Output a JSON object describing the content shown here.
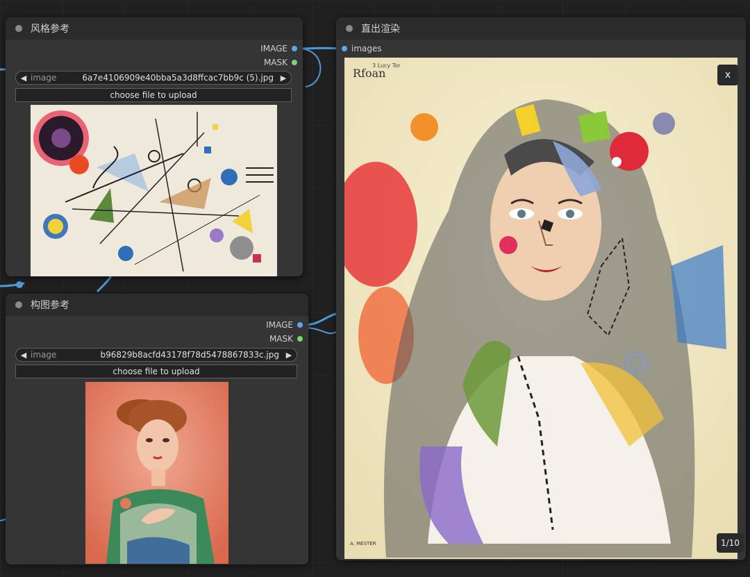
{
  "colors": {
    "image_slot": "#5fa8e8",
    "mask_slot": "#7ed27e",
    "wire": "#4f9ad8"
  },
  "style_node": {
    "title": "风格参考",
    "outputs": {
      "image": "IMAGE",
      "mask": "MASK"
    },
    "combo": {
      "label": "image",
      "value": "6a7e4106909e40bba5a3d8ffcac7bb9c (5).jpg"
    },
    "upload_label": "choose file to upload"
  },
  "composition_node": {
    "title": "构图参考",
    "outputs": {
      "image": "IMAGE",
      "mask": "MASK"
    },
    "combo": {
      "label": "image",
      "value": "b96829b8acfd43178f78d5478867833c.jpg"
    },
    "upload_label": "choose file to upload"
  },
  "render_node": {
    "title": "直出渲染",
    "input_label": "images",
    "close_label": "x",
    "counter": "1/10",
    "artwork_text": {
      "top_left": "Rfoan",
      "top_small": "3 Lucy Tor",
      "bottom_left": "A. MESTER"
    }
  },
  "icons": {
    "prev": "triangle-left-icon",
    "next": "triangle-right-icon",
    "collapse": "collapse-dot-icon"
  }
}
